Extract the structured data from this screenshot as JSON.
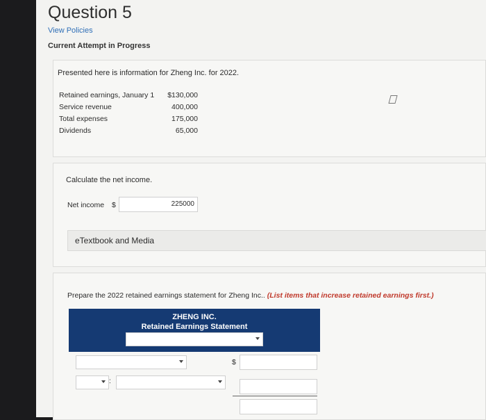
{
  "question": {
    "title": "Question 5",
    "policies_link": "View Policies",
    "attempt_status": "Current Attempt in Progress"
  },
  "info_card": {
    "intro": "Presented here is information for Zheng Inc. for 2022.",
    "rows": [
      {
        "label": "Retained earnings, January 1",
        "value": "$130,000"
      },
      {
        "label": "Service revenue",
        "value": "400,000"
      },
      {
        "label": "Total expenses",
        "value": "175,000"
      },
      {
        "label": "Dividends",
        "value": "65,000"
      }
    ]
  },
  "calc_card": {
    "prompt": "Calculate the net income.",
    "net_label": "Net income",
    "currency": "$",
    "net_value": "225000",
    "etextbook": "eTextbook and Media"
  },
  "statement_card": {
    "instruction": "Prepare the 2022 retained earnings statement for Zheng Inc..",
    "instruction_emphasis": "(List items that increase retained earnings first.)",
    "company": "ZHENG INC.",
    "statement_title": "Retained Earnings Statement",
    "currency": "$",
    "colon": ":"
  },
  "colors": {
    "header_bg": "#153a73",
    "link": "#2f6fb7",
    "emphasis": "#c0392b"
  }
}
